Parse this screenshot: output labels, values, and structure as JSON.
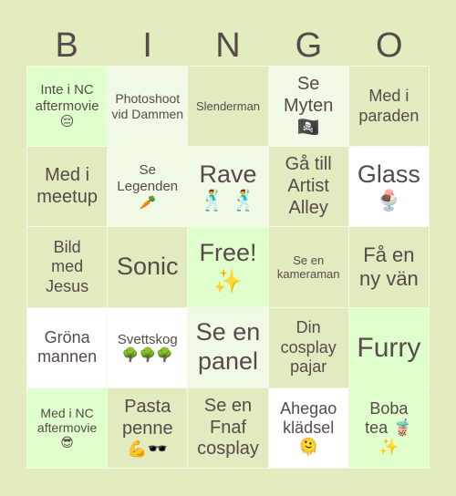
{
  "title_letters": [
    "B",
    "I",
    "N",
    "G",
    "O"
  ],
  "colors": {
    "background": "#e2ecbf",
    "text": "#574a4a",
    "cell_green": "#dfffcc",
    "cell_pale": "#f0f9e6",
    "cell_olive": "#e2ebbf",
    "cell_white": "#ffffff"
  },
  "cells": [
    {
      "text": "Inte i NC aftermovie",
      "emoji": "😔",
      "emoji_name": "pensive-face-icon"
    },
    {
      "text": "Photoshoot vid Dammen",
      "emoji": ""
    },
    {
      "text": "Slenderman",
      "emoji": ""
    },
    {
      "text": "Se Myten",
      "emoji": "🏴‍☠️",
      "emoji_name": "pirate-flag-icon"
    },
    {
      "text": "Med i paraden",
      "emoji": ""
    },
    {
      "text": "Med i meetup",
      "emoji": ""
    },
    {
      "text": "Se Legenden",
      "emoji": "🥕",
      "emoji_name": "carrot-icon"
    },
    {
      "text": "Rave",
      "emoji": "🕺 🕺",
      "emoji_name": "dancing-man-icon"
    },
    {
      "text": "Gå till Artist Alley",
      "emoji": ""
    },
    {
      "text": "Glass",
      "emoji": "🍨",
      "emoji_name": "ice-cream-icon"
    },
    {
      "text": "Bild med Jesus",
      "emoji": ""
    },
    {
      "text": "Sonic",
      "emoji": ""
    },
    {
      "text": "Free!",
      "emoji": "✨",
      "emoji_name": "sparkles-icon"
    },
    {
      "text": "Se en kameraman",
      "emoji": ""
    },
    {
      "text": "Få en ny vän",
      "emoji": ""
    },
    {
      "text": "Gröna mannen",
      "emoji": ""
    },
    {
      "text": "Svettskog",
      "emoji": "🌳🌳🌳",
      "emoji_name": "tree-icon"
    },
    {
      "text": "Se en panel",
      "emoji": ""
    },
    {
      "text": "Din cosplay pajar",
      "emoji": ""
    },
    {
      "text": "Furry",
      "emoji": ""
    },
    {
      "text": "Med i NC aftermovie",
      "emoji": "😎",
      "emoji_name": "sunglasses-face-icon"
    },
    {
      "text": "Pasta penne",
      "emoji": "💪🕶️",
      "emoji_name": "flexed-biceps-sunglasses-icon"
    },
    {
      "text": "Se en Fnaf cosplay",
      "emoji": ""
    },
    {
      "text": "Ahegao klädsel",
      "emoji": "🫠",
      "emoji_name": "melting-face-icon"
    },
    {
      "text": "Boba tea 🧋",
      "emoji": "✨",
      "emoji_name": "sparkles-icon"
    }
  ]
}
